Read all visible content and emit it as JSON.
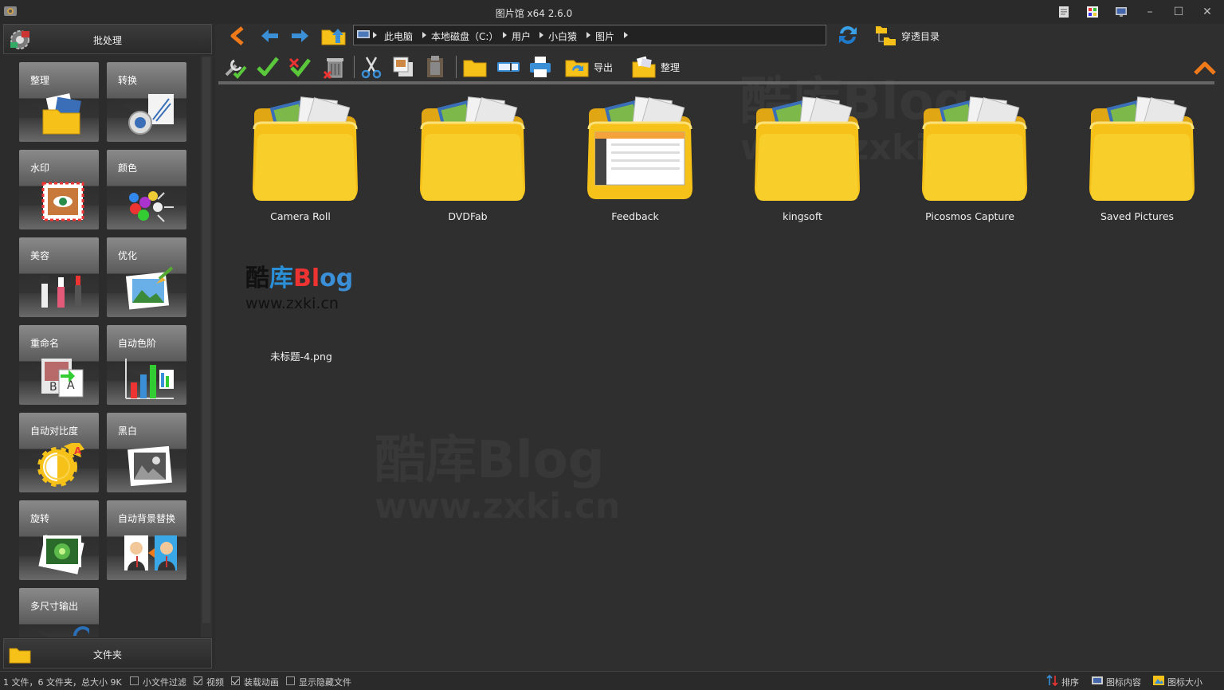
{
  "window": {
    "title": "图片馆 x64 2.6.0",
    "controls": {
      "minimize": "–",
      "maximize": "☐",
      "close": "✕"
    }
  },
  "left_panel": {
    "header_label": "批处理",
    "footer_label": "文件夹",
    "tools": [
      {
        "label": "整理",
        "icon": "organize-photos-icon"
      },
      {
        "label": "转换",
        "icon": "convert-icon"
      },
      {
        "label": "水印",
        "icon": "watermark-icon"
      },
      {
        "label": "颜色",
        "icon": "color-icon"
      },
      {
        "label": "美容",
        "icon": "beauty-icon"
      },
      {
        "label": "优化",
        "icon": "optimize-icon"
      },
      {
        "label": "重命名",
        "icon": "rename-icon"
      },
      {
        "label": "自动色阶",
        "icon": "auto-levels-icon"
      },
      {
        "label": "自动对比度",
        "icon": "auto-contrast-icon"
      },
      {
        "label": "黑白",
        "icon": "black-white-icon"
      },
      {
        "label": "旋转",
        "icon": "rotate-icon"
      },
      {
        "label": "自动背景替换",
        "icon": "background-replace-icon"
      },
      {
        "label": "多尺寸输出",
        "icon": "multi-size-output-icon"
      }
    ]
  },
  "address_bar": {
    "crumbs": [
      "此电脑",
      "本地磁盘（C:）",
      "用户",
      "小白猿",
      "图片"
    ]
  },
  "penetrate_label": "穿透目录",
  "toolbar": {
    "export_label": "导出",
    "organize_label": "整理"
  },
  "folders": [
    {
      "name": "Camera Roll"
    },
    {
      "name": "DVDFab"
    },
    {
      "name": "Feedback"
    },
    {
      "name": "kingsoft"
    },
    {
      "name": "Picosmos Capture"
    },
    {
      "name": "Saved Pictures"
    }
  ],
  "files": [
    {
      "name": "未标题-4.png"
    }
  ],
  "watermark": {
    "line1": "酷库Blog",
    "line2": "www.zxki.cn"
  },
  "status_bar": {
    "summary": "1 文件，6 文件夹，总大小 9K",
    "small_file_filter": "小文件过滤",
    "video": "视频",
    "load_animation": "装载动画",
    "show_hidden": "显示隐藏文件",
    "sort": "排序",
    "icon_content": "图标内容",
    "icon_size": "图标大小"
  },
  "colors": {
    "accent_orange": "#f07a1a",
    "nav_blue": "#3a8fd6",
    "folder_yellow": "#f6c21a"
  }
}
